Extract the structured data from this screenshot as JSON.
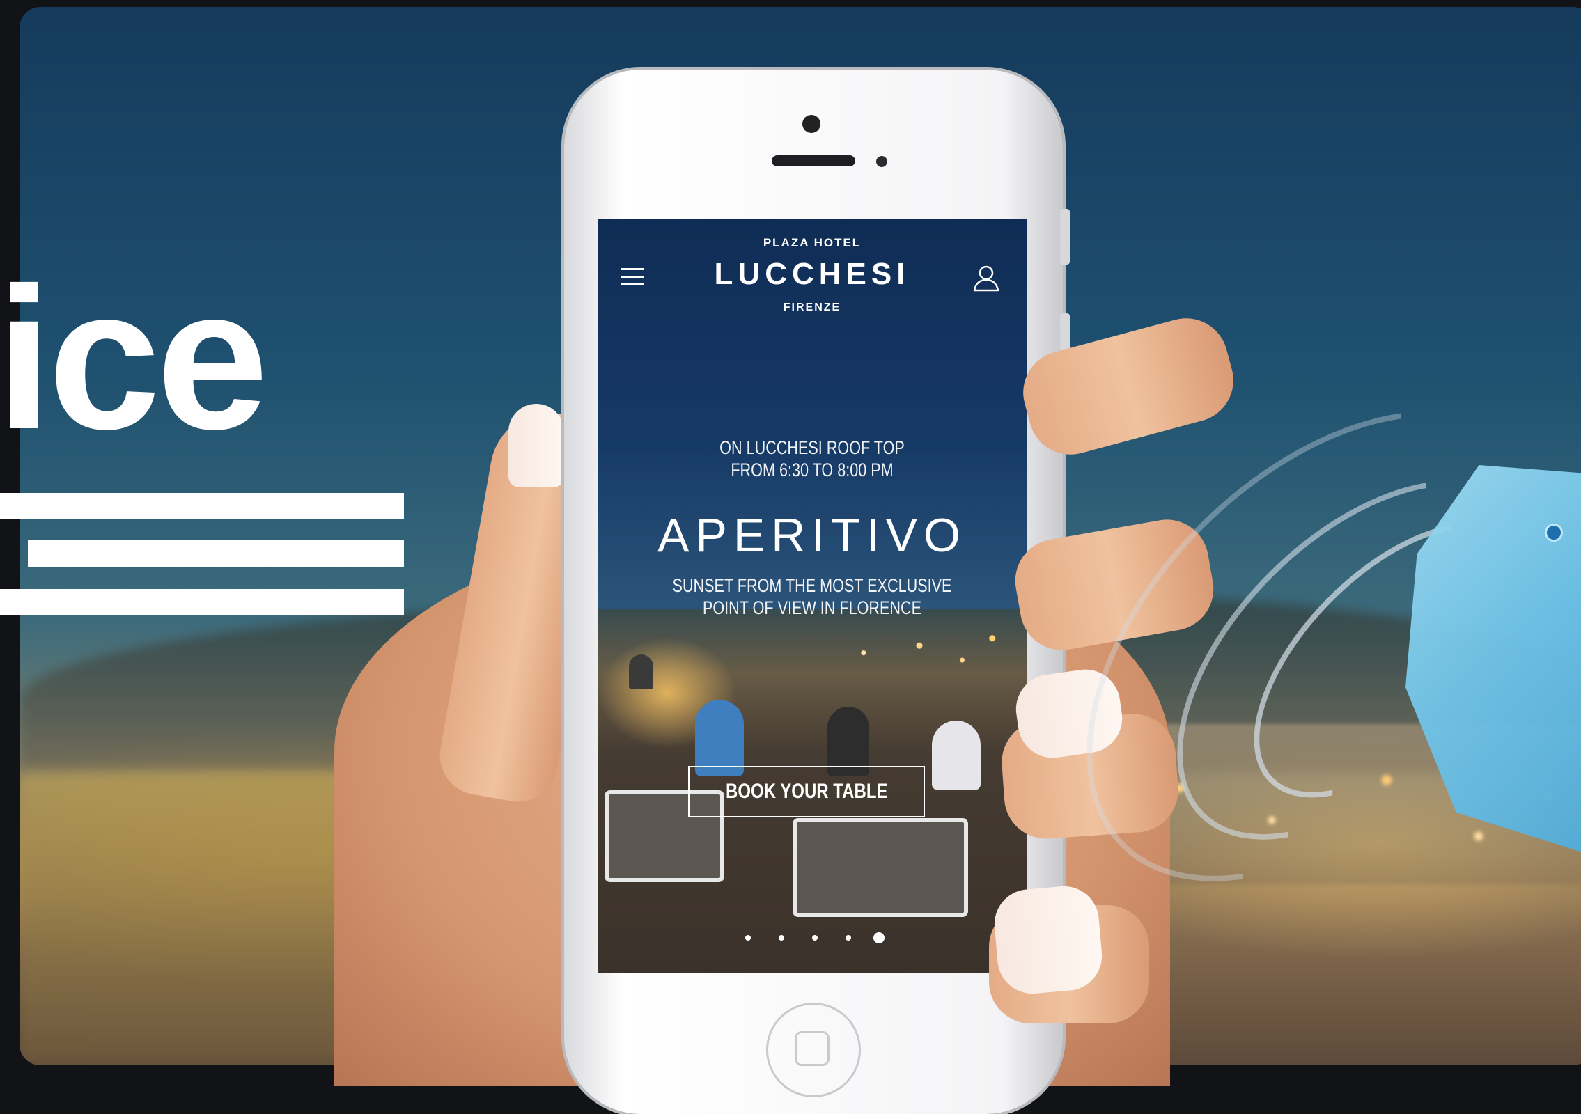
{
  "hero": {
    "title_fragment": "lice"
  },
  "app": {
    "brand_top": "PLAZA HOTEL",
    "brand_name": "LUCCHESI",
    "brand_city": "FIRENZE",
    "eyebrow_line1": "ON LUCCHESI ROOF TOP",
    "eyebrow_line2": "FROM 6:30 TO 8:00 PM",
    "headline": "APERITIVO",
    "subline_line1": "SUNSET FROM THE MOST EXCLUSIVE",
    "subline_line2": "POINT OF VIEW IN FLORENCE",
    "cta_label": "BOOK YOUR TABLE",
    "carousel": {
      "total": 5,
      "active_index": 5
    }
  },
  "icons": {
    "menu": "hamburger-menu-icon",
    "account": "user-icon",
    "hero_decoration": "hamburger-menu-icon",
    "beacon": "bluetooth-beacon-icon"
  },
  "colors": {
    "sky": "#163a66",
    "beacon": "#6fc3e8",
    "text": "#ffffff"
  }
}
